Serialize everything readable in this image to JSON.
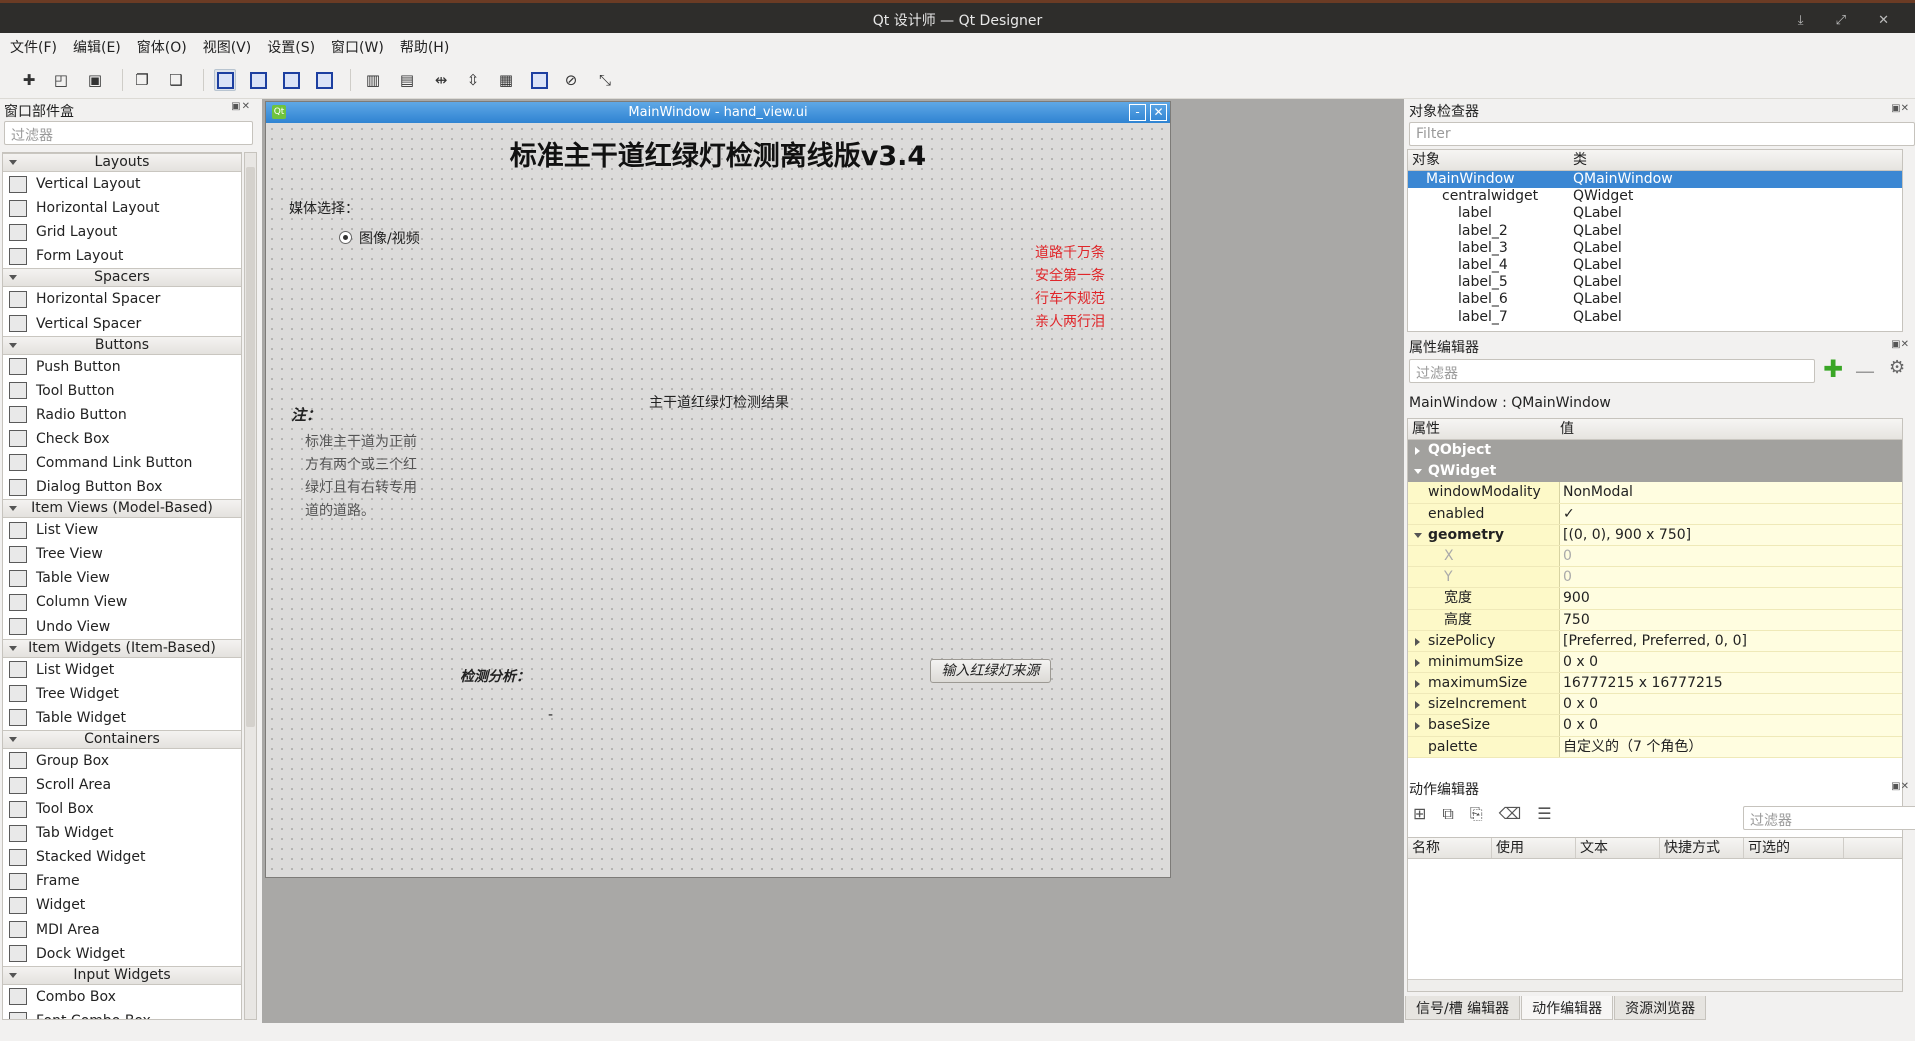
{
  "window": {
    "title": "Qt 设计师 — Qt Designer"
  },
  "menu": [
    "文件(F)",
    "编辑(E)",
    "窗体(O)",
    "视图(V)",
    "设置(S)",
    "窗口(W)",
    "帮助(H)"
  ],
  "widget_box": {
    "title": "窗口部件盒",
    "filter_placeholder": "过滤器",
    "categories": [
      {
        "name": "Layouts",
        "items": [
          "Vertical Layout",
          "Horizontal Layout",
          "Grid Layout",
          "Form Layout"
        ]
      },
      {
        "name": "Spacers",
        "items": [
          "Horizontal Spacer",
          "Vertical Spacer"
        ]
      },
      {
        "name": "Buttons",
        "items": [
          "Push Button",
          "Tool Button",
          "Radio Button",
          "Check Box",
          "Command Link Button",
          "Dialog Button Box"
        ]
      },
      {
        "name": "Item Views (Model-Based)",
        "items": [
          "List View",
          "Tree View",
          "Table View",
          "Column View",
          "Undo View"
        ]
      },
      {
        "name": "Item Widgets (Item-Based)",
        "items": [
          "List Widget",
          "Tree Widget",
          "Table Widget"
        ]
      },
      {
        "name": "Containers",
        "items": [
          "Group Box",
          "Scroll Area",
          "Tool Box",
          "Tab Widget",
          "Stacked Widget",
          "Frame",
          "Widget",
          "MDI Area",
          "Dock Widget"
        ]
      },
      {
        "name": "Input Widgets",
        "items": [
          "Combo Box",
          "Font Combo Box"
        ]
      }
    ]
  },
  "form": {
    "window_title": "MainWindow - hand_view.ui",
    "heading": "标准主干道红绿灯检测离线版v3.4",
    "media_label": "媒体选择：",
    "radio_label": "图像/视频",
    "slogan": [
      "道路千万条",
      "安全第一条",
      "行车不规范",
      "亲人两行泪"
    ],
    "note_title": "注：",
    "note_lines": [
      "标准主干道为正前",
      "方有两个或三个红",
      "绿灯且有右转专用",
      "道的道路。"
    ],
    "result_label": "主干道红绿灯检测结果",
    "analysis_label": "检测分析：",
    "dash": "-",
    "source_button": "输入红绿灯来源"
  },
  "object_inspector": {
    "title": "对象检查器",
    "filter_placeholder": "Filter",
    "col_object": "对象",
    "col_class": "类",
    "rows": [
      {
        "name": "MainWindow",
        "cls": "QMainWindow"
      },
      {
        "name": "centralwidget",
        "cls": "QWidget"
      },
      {
        "name": "label",
        "cls": "QLabel"
      },
      {
        "name": "label_2",
        "cls": "QLabel"
      },
      {
        "name": "label_3",
        "cls": "QLabel"
      },
      {
        "name": "label_4",
        "cls": "QLabel"
      },
      {
        "name": "label_5",
        "cls": "QLabel"
      },
      {
        "name": "label_6",
        "cls": "QLabel"
      },
      {
        "name": "label_7",
        "cls": "QLabel"
      }
    ]
  },
  "property_editor": {
    "title": "属性编辑器",
    "filter_placeholder": "过滤器",
    "context": "MainWindow : QMainWindow",
    "col_prop": "属性",
    "col_value": "值",
    "rows": [
      {
        "n": "QObject",
        "v": "",
        "grp": true
      },
      {
        "n": "QWidget",
        "v": "",
        "grp": true,
        "open": true
      },
      {
        "n": "windowModality",
        "v": "NonModal"
      },
      {
        "n": "enabled",
        "v": "✓"
      },
      {
        "n": "geometry",
        "v": "[(0, 0), 900 x 750]",
        "bold": true,
        "exp": true,
        "open": true
      },
      {
        "n": "X",
        "v": "0",
        "dim": true,
        "sub": true
      },
      {
        "n": "Y",
        "v": "0",
        "dim": true,
        "sub": true
      },
      {
        "n": "宽度",
        "v": "900",
        "sub": true
      },
      {
        "n": "高度",
        "v": "750",
        "sub": true
      },
      {
        "n": "sizePolicy",
        "v": "[Preferred, Preferred, 0, 0]",
        "exp": true
      },
      {
        "n": "minimumSize",
        "v": "0 x 0",
        "exp": true
      },
      {
        "n": "maximumSize",
        "v": "16777215 x 16777215",
        "exp": true
      },
      {
        "n": "sizeIncrement",
        "v": "0 x 0",
        "exp": true
      },
      {
        "n": "baseSize",
        "v": "0 x 0",
        "exp": true
      },
      {
        "n": "palette",
        "v": "自定义的（7 个角色）"
      }
    ]
  },
  "action_editor": {
    "title": "动作编辑器",
    "filter_placeholder": "过滤器",
    "columns": [
      "名称",
      "使用",
      "文本",
      "快捷方式",
      "可选的"
    ]
  },
  "bottom_tabs": [
    "信号/槽 编辑器",
    "动作编辑器",
    "资源浏览器"
  ],
  "colors": {
    "accent": "#3b87d3",
    "slogan": "#e0262a",
    "property_bg": "#fdf9c8"
  }
}
